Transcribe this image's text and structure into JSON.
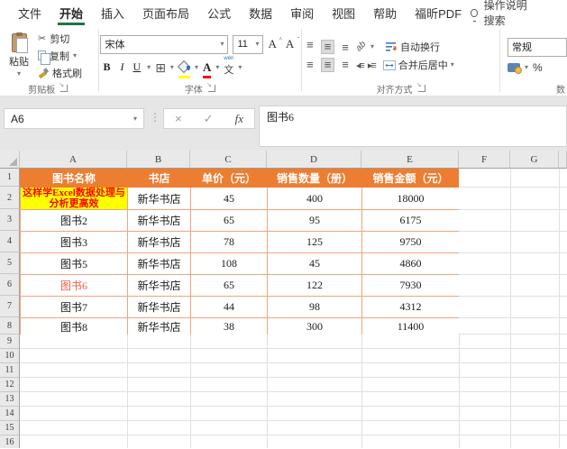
{
  "tabs": {
    "items": [
      {
        "label": "文件",
        "active": false
      },
      {
        "label": "开始",
        "active": true
      },
      {
        "label": "插入",
        "active": false
      },
      {
        "label": "页面布局",
        "active": false
      },
      {
        "label": "公式",
        "active": false
      },
      {
        "label": "数据",
        "active": false
      },
      {
        "label": "审阅",
        "active": false
      },
      {
        "label": "视图",
        "active": false
      },
      {
        "label": "帮助",
        "active": false
      },
      {
        "label": "福昕PDF",
        "active": false
      }
    ],
    "search_label": "操作说明搜索"
  },
  "ribbon": {
    "clipboard": {
      "label": "剪贴板",
      "paste": "粘贴",
      "cut": "剪切",
      "copy": "复制",
      "format_painter": "格式刷"
    },
    "font": {
      "label": "字体",
      "font_name": "宋体",
      "font_size": "11",
      "bold": "B",
      "italic": "I",
      "underline": "U",
      "phonetic": "文",
      "phonetic_ruby": "wén"
    },
    "alignment": {
      "label": "对齐方式",
      "wrap_text": "自动换行",
      "merge_center": "合并后居中",
      "orientation": "ab"
    },
    "number": {
      "label": "数",
      "format": "常规",
      "percent": "%"
    }
  },
  "formula_bar": {
    "name_box": "A6",
    "fx_label": "fx",
    "cancel": "×",
    "enter": "✓",
    "formula": "图书6"
  },
  "sheet": {
    "column_letters": [
      "A",
      "B",
      "C",
      "D",
      "E",
      "F",
      "G"
    ],
    "row_numbers": [
      "1",
      "2",
      "3",
      "4",
      "5",
      "6",
      "7",
      "8",
      "9",
      "10",
      "11",
      "12",
      "13",
      "14",
      "15",
      "16"
    ],
    "table": {
      "headers": [
        "图书名称",
        "书店",
        "单价（元）",
        "销售数量（册）",
        "销售金额（元）"
      ],
      "rows": [
        {
          "cells": [
            "这样学Excel数据处理与分析更高效",
            "新华书店",
            "45",
            "400",
            "18000"
          ]
        },
        {
          "cells": [
            "图书2",
            "新华书店",
            "65",
            "95",
            "6175"
          ]
        },
        {
          "cells": [
            "图书3",
            "新华书店",
            "78",
            "125",
            "9750"
          ]
        },
        {
          "cells": [
            "图书5",
            "新华书店",
            "108",
            "45",
            "4860"
          ]
        },
        {
          "cells": [
            "图书6",
            "新华书店",
            "65",
            "122",
            "7930"
          ]
        },
        {
          "cells": [
            "图书7",
            "新华书店",
            "44",
            "98",
            "4312"
          ]
        },
        {
          "cells": [
            "图书8",
            "新华书店",
            "38",
            "300",
            "11400"
          ]
        }
      ]
    },
    "selection": {
      "active_cell": "A6",
      "active_value": "图书6"
    },
    "colors": {
      "accent_green": "#217346",
      "table_header_fill": "#ED7D31",
      "table_header_text": "#FFFFFF",
      "highlight_cell_fill": "#FFFF00",
      "highlight_cell_text": "#FF0000",
      "special_cell_text": "#E8604C",
      "table_border": "#EFA57B"
    }
  }
}
